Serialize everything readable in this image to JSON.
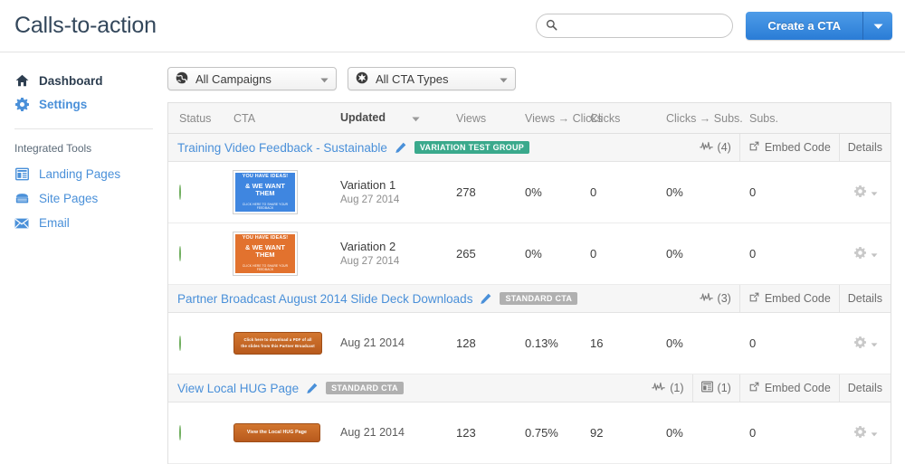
{
  "header": {
    "title": "Calls-to-action",
    "search": {
      "value": "",
      "placeholder": ""
    },
    "create_button": "Create a CTA"
  },
  "sidebar": {
    "primary": [
      {
        "label": "Dashboard",
        "icon": "home-icon",
        "active": true
      },
      {
        "label": "Settings",
        "icon": "gear-icon",
        "active": false
      }
    ],
    "section_title": "Integrated Tools",
    "tools": [
      {
        "label": "Landing Pages",
        "icon": "landing-page-icon"
      },
      {
        "label": "Site Pages",
        "icon": "site-page-icon"
      },
      {
        "label": "Email",
        "icon": "envelope-icon"
      }
    ]
  },
  "filters": [
    {
      "label": "All Campaigns",
      "icon": "globe-icon"
    },
    {
      "label": "All CTA Types",
      "icon": "starburst-icon"
    }
  ],
  "table": {
    "columns": {
      "status": "Status",
      "cta": "CTA",
      "updated": "Updated",
      "views": "Views",
      "views_to_clicks": "Views → Clicks",
      "clicks": "Clicks",
      "clicks_to_subs": "Clicks → Subs.",
      "subs": "Subs."
    },
    "actions": {
      "embed_code": "Embed Code",
      "details": "Details"
    },
    "groups": [
      {
        "title": "Training Video Feedback - Sustainable",
        "badge": "VARIATION TEST GROUP",
        "badge_type": "variation",
        "analytics_count": "(4)",
        "pages_count": null,
        "rows": [
          {
            "status": "active",
            "thumb": {
              "kind": "banner",
              "color": "blue",
              "line1": "YOU HAVE IDEAS!",
              "line2": "& WE WANT THEM",
              "line3": "CLICK HERE TO SHARE YOUR FEEDBACK"
            },
            "name": "Variation 1",
            "date": "Aug 27 2014",
            "views": "278",
            "views_to_clicks": "0%",
            "clicks": "0",
            "clicks_to_subs": "0%",
            "subs": "0"
          },
          {
            "status": "active",
            "thumb": {
              "kind": "banner",
              "color": "orange",
              "line1": "YOU HAVE IDEAS!",
              "line2": "& WE WANT THEM",
              "line3": "CLICK HERE TO SHARE YOUR FEEDBACK"
            },
            "name": "Variation 2",
            "date": "Aug 27 2014",
            "views": "265",
            "views_to_clicks": "0%",
            "clicks": "0",
            "clicks_to_subs": "0%",
            "subs": "0"
          }
        ]
      },
      {
        "title": "Partner Broadcast August 2014 Slide Deck Downloads",
        "badge": "STANDARD CTA",
        "badge_type": "standard",
        "analytics_count": "(3)",
        "pages_count": null,
        "rows": [
          {
            "status": "active",
            "thumb": {
              "kind": "button",
              "size": "wide",
              "line1": "Click here to download a PDF of all",
              "line2": "the slides from this Partner Broadcast"
            },
            "name": "",
            "date": "Aug 21 2014",
            "views": "128",
            "views_to_clicks": "0.13%",
            "clicks": "16",
            "clicks_to_subs": "0%",
            "subs": "0"
          }
        ]
      },
      {
        "title": "View Local HUG Page",
        "badge": "STANDARD CTA",
        "badge_type": "standard",
        "analytics_count": "(1)",
        "pages_count": "(1)",
        "rows": [
          {
            "status": "active",
            "thumb": {
              "kind": "button",
              "size": "small",
              "line1": "View the Local HUG Page",
              "line2": ""
            },
            "name": "",
            "date": "Aug 21 2014",
            "views": "123",
            "views_to_clicks": "0.75%",
            "clicks": "92",
            "clicks_to_subs": "0%",
            "subs": "0"
          }
        ]
      }
    ]
  },
  "colors": {
    "accent_blue": "#4a90d9",
    "button_blue": "#2a7cd6",
    "badge_variation": "#3aa98c",
    "badge_standard": "#b0b0b0",
    "status_green": "#79bd68"
  }
}
